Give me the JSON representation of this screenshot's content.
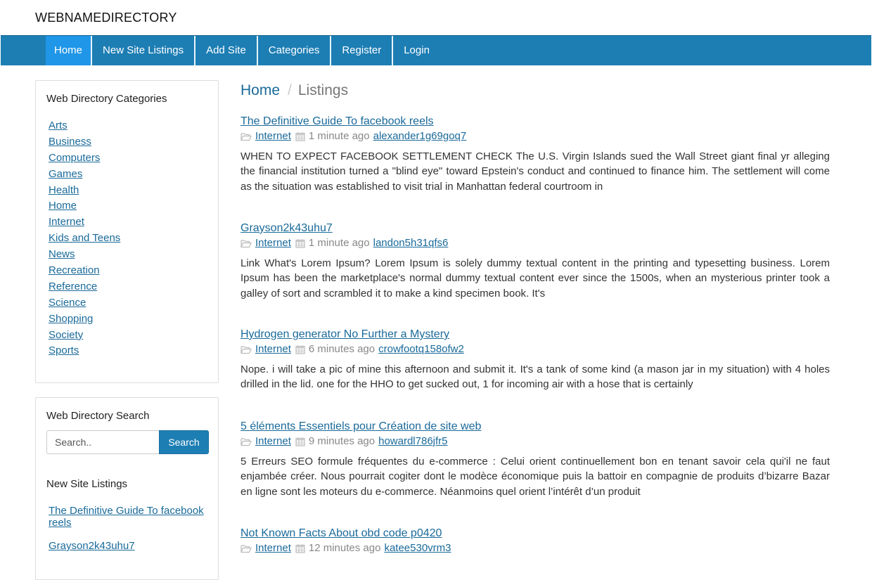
{
  "brand": "WEBNAMEDIRECTORY",
  "nav": [
    "Home",
    "New Site Listings",
    "Add Site",
    "Categories",
    "Register",
    "Login"
  ],
  "categories_panel": {
    "title": "Web Directory Categories",
    "items": [
      "Arts",
      "Business",
      "Computers",
      "Games",
      "Health",
      "Home",
      "Internet",
      "Kids and Teens",
      "News",
      "Recreation",
      "Reference",
      "Science",
      "Shopping",
      "Society",
      "Sports"
    ]
  },
  "search_panel": {
    "title": "Web Directory Search",
    "placeholder": "Search..",
    "button": "Search",
    "new_title": "New Site Listings",
    "new_items": [
      "The Definitive Guide To facebook reels",
      "Grayson2k43uhu7"
    ]
  },
  "breadcrumb": {
    "home": "Home",
    "sep": "/",
    "current": "Listings"
  },
  "listings": [
    {
      "title": "The Definitive Guide To facebook reels",
      "category": "Internet",
      "time": "1 minute ago",
      "user": "alexander1g69goq7",
      "desc": "WHEN TO EXPECT FACEBOOK SETTLEMENT CHECK The U.S. Virgin Islands sued the Wall Street giant final yr alleging the financial institution turned a \"blind eye\" toward Epstein's conduct and continued to finance him. The settlement will come as the situation was established to visit trial in Manhattan federal courtroom in"
    },
    {
      "title": "Grayson2k43uhu7",
      "category": "Internet",
      "time": "1 minute ago",
      "user": "landon5h31qfs6",
      "desc": "Link What's Lorem Ipsum? Lorem Ipsum is solely dummy textual content in the printing and typesetting business. Lorem Ipsum has been the marketplace's normal dummy textual content ever since the 1500s, when an mysterious printer took a galley of sort and scrambled it to make a kind specimen book. It's"
    },
    {
      "title": "Hydrogen generator No Further a Mystery",
      "category": "Internet",
      "time": "6 minutes ago",
      "user": "crowfootq158ofw2",
      "desc": "Nope. i will take a pic of mine this afternoon and submit it. It's a tank of some kind (a mason jar in my situation) with 4 holes drilled in the lid. one for the HHO to get sucked out, 1 for incoming air with a hose that is certainly"
    },
    {
      "title": "5 éléments Essentiels pour Création de site web",
      "category": "Internet",
      "time": "9 minutes ago",
      "user": "howardl786jfr5",
      "desc": "5 Erreurs SEO formule fréquentes du e-commerce : Celui orient continuellement bon en tenant savoir cela qui'il ne faut enjambée créer. Nous pourrait cogiter dont le modèce économique puis la battoir en compagnie de produits d’bizarre Bazar en ligne sont les moteurs du e-commerce. Néanmoins quel orient l’intérêt d’un produit"
    },
    {
      "title": "Not Known Facts About obd code p0420",
      "category": "Internet",
      "time": "12 minutes ago",
      "user": "katee530vrm3",
      "desc": ""
    }
  ]
}
